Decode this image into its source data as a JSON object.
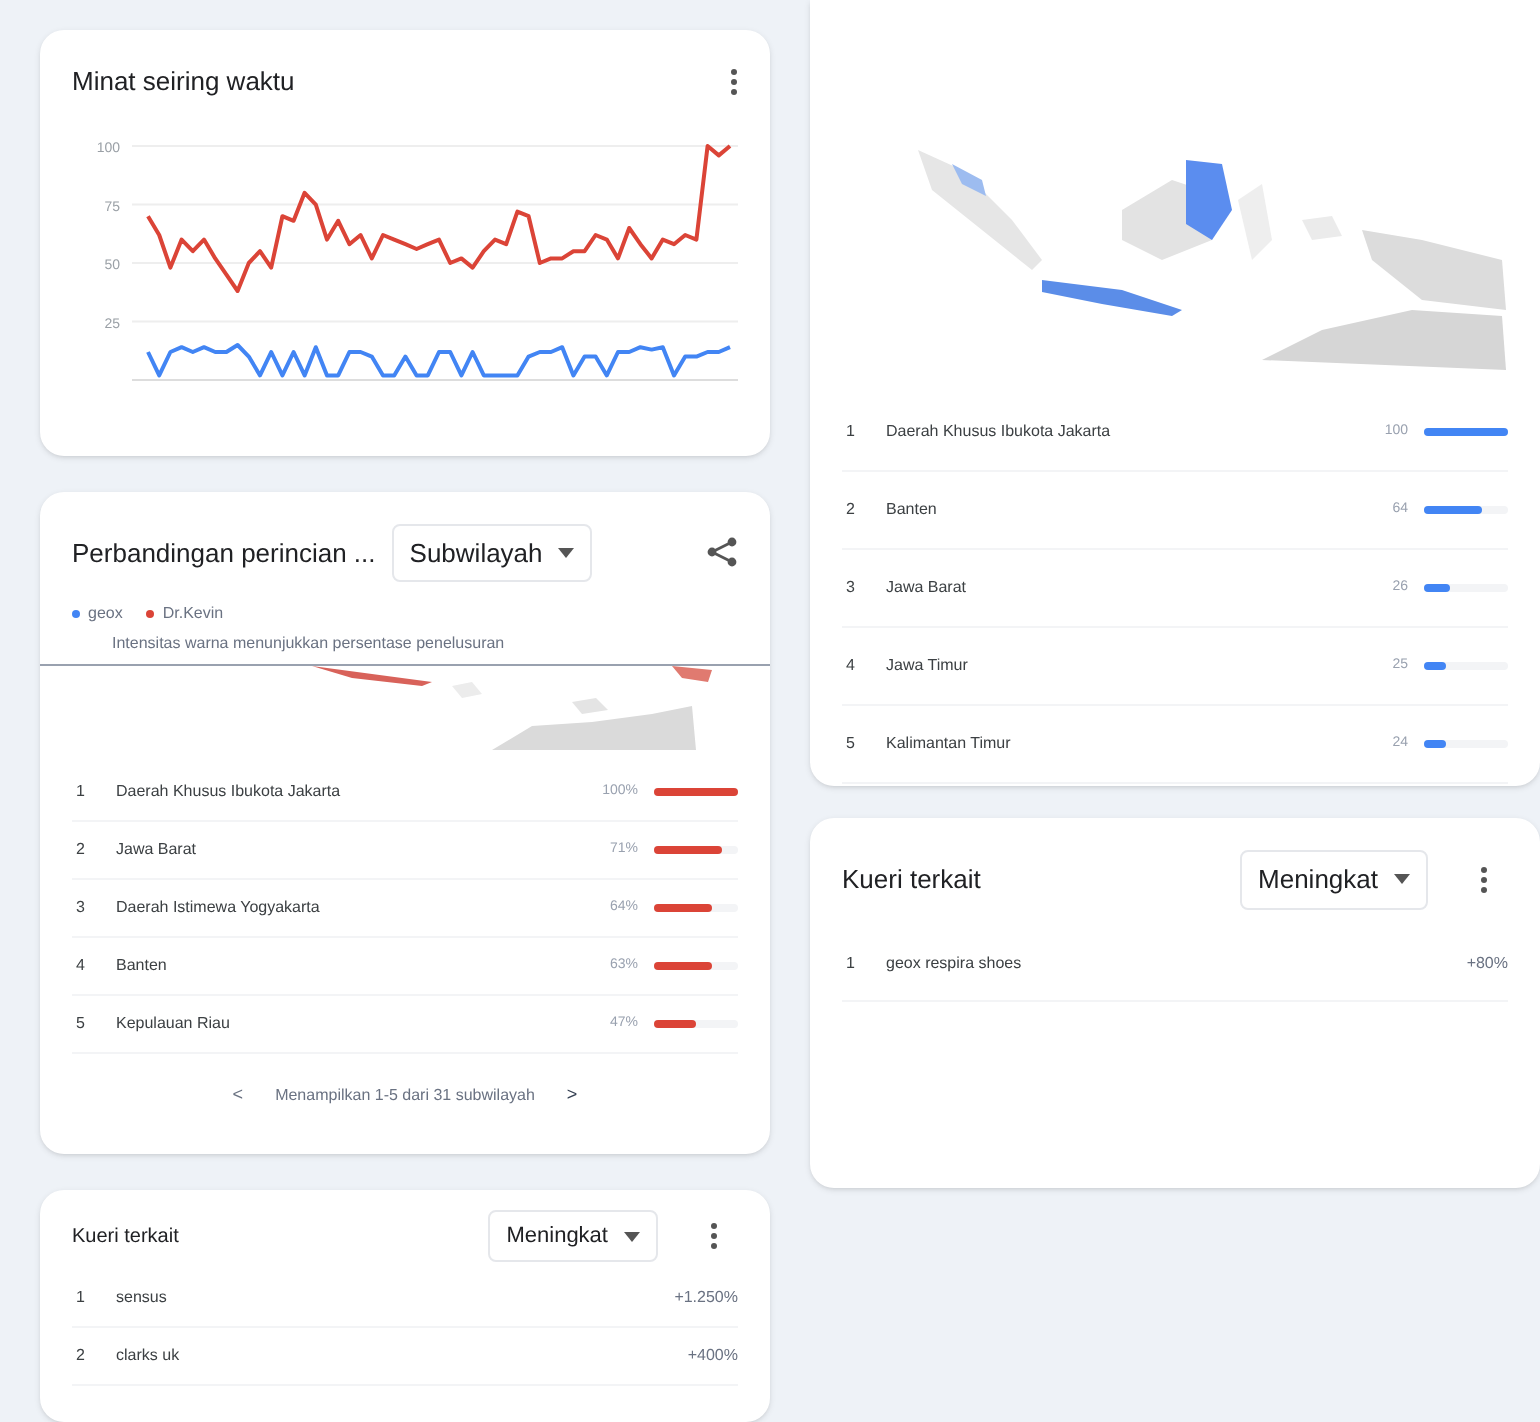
{
  "interest_card": {
    "title": "Minat seiring waktu",
    "chart_data": {
      "type": "line",
      "grid": true,
      "ylim": [
        0,
        100
      ],
      "yticks": [
        25,
        50,
        75,
        100
      ],
      "series": [
        {
          "color": "#db4437",
          "values": [
            70,
            62,
            48,
            60,
            55,
            60,
            52,
            45,
            38,
            50,
            55,
            48,
            70,
            68,
            80,
            75,
            60,
            68,
            58,
            62,
            52,
            62,
            60,
            58,
            56,
            58,
            60,
            50,
            52,
            48,
            55,
            60,
            58,
            72,
            70,
            50,
            52,
            52,
            55,
            55,
            62,
            60,
            52,
            65,
            58,
            52,
            60,
            58,
            62,
            60,
            100,
            96,
            100
          ]
        },
        {
          "color": "#4285f4",
          "values": [
            12,
            2,
            12,
            14,
            12,
            14,
            12,
            12,
            15,
            10,
            2,
            12,
            2,
            12,
            2,
            14,
            2,
            2,
            12,
            12,
            10,
            2,
            2,
            10,
            2,
            2,
            12,
            12,
            2,
            12,
            2,
            2,
            2,
            2,
            10,
            12,
            12,
            14,
            2,
            10,
            10,
            2,
            12,
            12,
            14,
            13,
            14,
            2,
            10,
            10,
            12,
            12,
            14
          ]
        }
      ]
    }
  },
  "breakdown_card": {
    "title": "Perbandingan perincian ...",
    "dropdown": "Subwilayah",
    "legend": [
      {
        "label": "geox",
        "color": "#4285f4"
      },
      {
        "label": "Dr.Kevin",
        "color": "#db4437"
      }
    ],
    "note": "Intensitas warna menunjukkan persentase penelusuran",
    "rows": [
      {
        "rank": "1",
        "name": "Daerah Khusus Ibukota Jakarta",
        "value": "100%",
        "level": 1
      },
      {
        "rank": "2",
        "name": "Jawa Barat",
        "value": "71%",
        "level": 0.8
      },
      {
        "rank": "3",
        "name": "Daerah Istimewa Yogyakarta",
        "value": "64%",
        "level": 0.7
      },
      {
        "rank": "4",
        "name": "Banten",
        "value": "63%",
        "level": 0.7
      },
      {
        "rank": "5",
        "name": "Kepulauan Riau",
        "value": "47%",
        "level": 0.5
      }
    ],
    "pager": {
      "prev": "<",
      "text": "Menampilkan 1-5 dari 31 subwilayah",
      "next": ">"
    }
  },
  "queries_left": {
    "title": "Kueri terkait",
    "dropdown": "Meningkat",
    "rows": [
      {
        "rank": "1",
        "query": "sensus",
        "value": "+1.250%"
      },
      {
        "rank": "2",
        "query": "clarks uk",
        "value": "+400%"
      }
    ]
  },
  "region_card": {
    "rows": [
      {
        "rank": "1",
        "name": "Daerah Khusus Ibukota Jakarta",
        "value": "100",
        "level": 1
      },
      {
        "rank": "2",
        "name": "Banten",
        "value": "64",
        "level": 0.7
      },
      {
        "rank": "3",
        "name": "Jawa Barat",
        "value": "26",
        "level": 0.3
      },
      {
        "rank": "4",
        "name": "Jawa Timur",
        "value": "25",
        "level": 0.25
      },
      {
        "rank": "5",
        "name": "Kalimantan Timur",
        "value": "24",
        "level": 0.25
      }
    ]
  },
  "queries_right": {
    "title": "Kueri terkait",
    "dropdown": "Meningkat",
    "rows": [
      {
        "rank": "1",
        "query": "geox respira shoes",
        "value": "+80%"
      }
    ]
  }
}
